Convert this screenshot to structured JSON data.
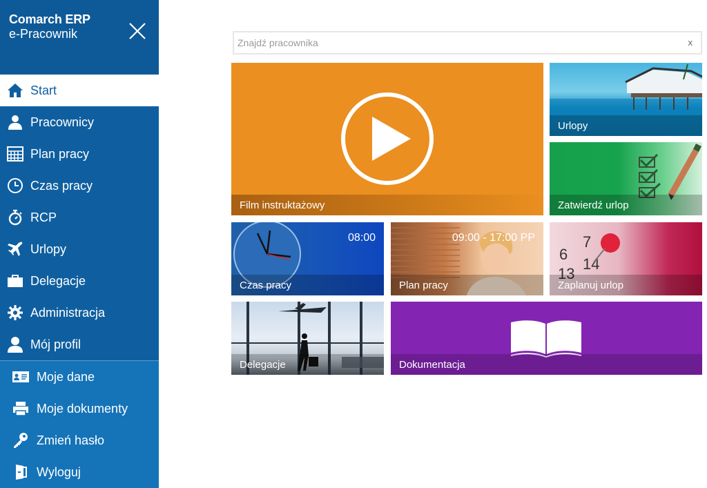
{
  "brand": {
    "title": "Comarch ERP",
    "subtitle": "e-Pracownik"
  },
  "nav": {
    "items": [
      {
        "label": "Start",
        "icon": "home-icon"
      },
      {
        "label": "Pracownicy",
        "icon": "users-icon"
      },
      {
        "label": "Plan pracy",
        "icon": "calendar-icon"
      },
      {
        "label": "Czas pracy",
        "icon": "clock-icon"
      },
      {
        "label": "RCP",
        "icon": "stopwatch-icon"
      },
      {
        "label": "Urlopy",
        "icon": "airplane-icon"
      },
      {
        "label": "Delegacje",
        "icon": "briefcase-icon"
      },
      {
        "label": "Administracja",
        "icon": "gear-icon"
      },
      {
        "label": "Mój profil",
        "icon": "user-icon"
      }
    ],
    "subitems": [
      {
        "label": "Moje dane",
        "icon": "id-card-icon"
      },
      {
        "label": "Moje dokumenty",
        "icon": "printer-icon"
      },
      {
        "label": "Zmień hasło",
        "icon": "key-icon"
      },
      {
        "label": "Wyloguj",
        "icon": "logout-icon"
      }
    ],
    "active": "Start"
  },
  "search": {
    "placeholder": "Znajdź pracownika",
    "clear_label": "x"
  },
  "tiles": {
    "film": {
      "label": "Film instruktażowy",
      "color": "#ea8f20"
    },
    "urlopy": {
      "label": "Urlopy"
    },
    "zatwierdz": {
      "label": "Zatwierdź urlop"
    },
    "czas": {
      "label": "Czas pracy",
      "time": "08:00"
    },
    "plan": {
      "label": "Plan pracy",
      "time": "09:00 - 17:00 PP"
    },
    "zaplanuj": {
      "label": "Zaplanuj urlop"
    },
    "delegacje": {
      "label": "Delegacje"
    },
    "dokumentacja": {
      "label": "Dokumentacja",
      "color": "#8424b3"
    }
  },
  "colors": {
    "sidebar": "#0f5fa0",
    "subnav": "#1573b8"
  }
}
